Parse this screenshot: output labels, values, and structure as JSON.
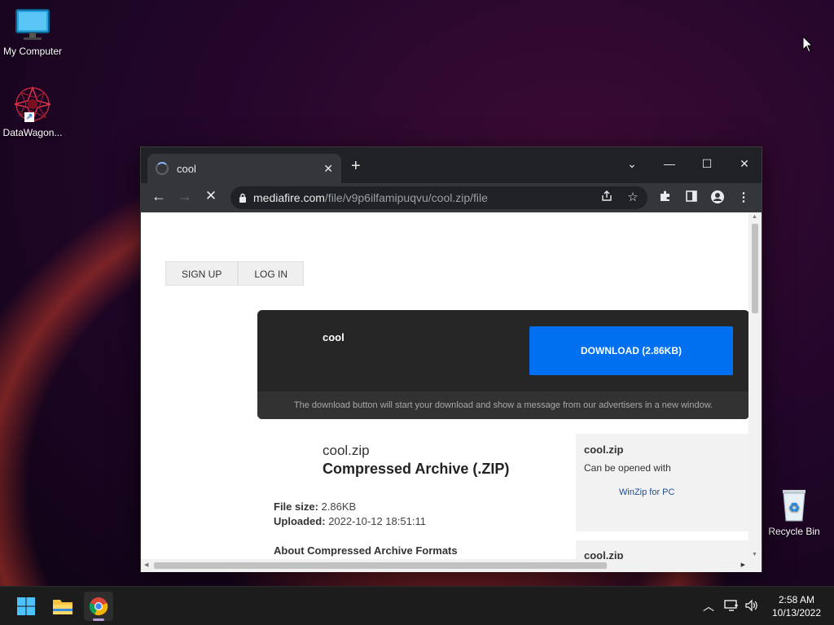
{
  "desktop": {
    "icons": [
      {
        "label": "My Computer"
      },
      {
        "label": "DataWagon..."
      },
      {
        "label": "Recycle Bin"
      }
    ]
  },
  "browser": {
    "tab": {
      "title": "cool",
      "close_glyph": "✕"
    },
    "new_tab_glyph": "+",
    "window_controls": {
      "dropdown": "⌄",
      "minimize": "—",
      "maximize": "☐",
      "close": "✕"
    },
    "nav": {
      "back": "←",
      "forward": "→",
      "stop": "✕"
    },
    "address": {
      "host": "mediafire.com",
      "path": "/file/v9p6ilfamipuqvu/cool.zip/file"
    }
  },
  "page": {
    "auth": {
      "sign_up": "SIGN UP",
      "log_in": "LOG IN"
    },
    "download_box": {
      "file_name": "cool",
      "button_label": "DOWNLOAD (2.86KB)",
      "note": "The download button will start your download and show a message from our advertisers in a new window."
    },
    "file": {
      "name": "cool.zip",
      "type": "Compressed Archive (.ZIP)",
      "size_label": "File size:",
      "size_value": "2.86KB",
      "uploaded_label": "Uploaded:",
      "uploaded_value": "2022-10-12 18:51:11",
      "about_heading": "About Compressed Archive Formats"
    },
    "sidebar": {
      "card1_title": "cool.zip",
      "card1_subtitle": "Can be opened with",
      "card1_link": "WinZip for PC",
      "card2_title": "cool.zip"
    }
  },
  "taskbar": {
    "clock_time": "2:58 AM",
    "clock_date": "10/13/2022"
  },
  "colors": {
    "download_button": "#0070f0",
    "download_box_bg": "#262626",
    "browser_frame": "#202124"
  }
}
